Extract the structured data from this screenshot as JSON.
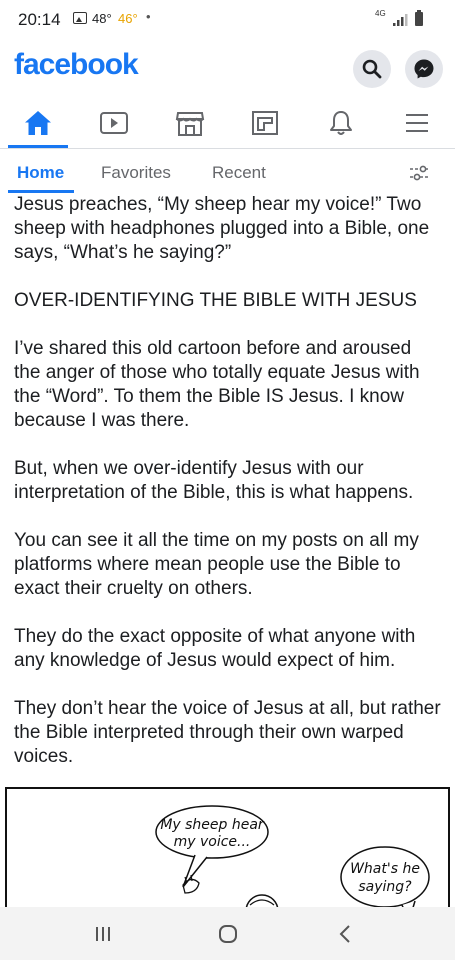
{
  "status_bar": {
    "time": "20:14",
    "temp1": "48°",
    "temp2": "46°",
    "dot": "•",
    "network": "4G"
  },
  "header": {
    "logo": "facebook",
    "accent": "#1877f2"
  },
  "nav": {
    "icons": [
      "home-icon",
      "watch-icon",
      "marketplace-icon",
      "pages-icon",
      "notifications-icon",
      "menu-icon"
    ],
    "active": "home"
  },
  "tabs": [
    "Home",
    "Favorites",
    "Recent"
  ],
  "post": {
    "paragraphs": [
      "Jesus preaches, “My sheep hear my voice!” Two sheep with headphones plugged into a Bible, one says, “What’s he saying?”",
      "OVER-IDENTIFYING THE BIBLE WITH JESUS",
      "I’ve shared this old cartoon before and aroused the anger of those who totally equate Jesus with the “Word”. To them the Bible IS Jesus. I know because I was there.",
      "But, when we over-identify Jesus with our interpretation of the Bible, this is what happens.",
      "You can see it all the time on my posts on all my platforms where mean people use the Bible to exact their cruelty on others.",
      "They do the exact opposite of what anyone with any knowledge of Jesus would expect of him.",
      "They don’t hear the voice of Jesus at all, but rather the Bible interpreted through their own warped voices."
    ]
  },
  "cartoon": {
    "bubble1_line1": "My sheep hear",
    "bubble1_line2": "my voice...",
    "bubble2_line1": "What's he",
    "bubble2_line2": "saying?"
  }
}
